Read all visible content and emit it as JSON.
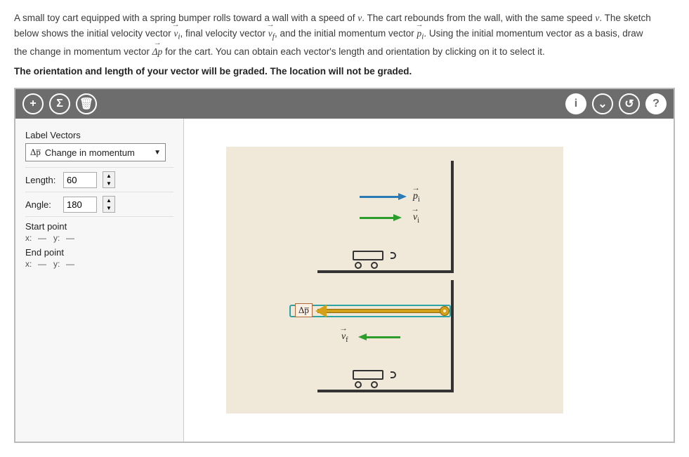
{
  "instructions": {
    "line1a": "A small toy cart equipped with a spring bumper rolls toward a wall with a speed of ",
    "v": "v",
    "line1b": ". The cart rebounds from the wall, with the same speed ",
    "line1c": ". The sketch",
    "line2a": "below shows the initial velocity vector ",
    "vi": "v",
    "vi_sub": "i",
    "line2b": ", final velocity vector ",
    "vf": "v",
    "vf_sub": "f",
    "line2c": ", and the initial momentum vector ",
    "pi": "p",
    "pi_sub": "i",
    "line2d": ". Using the initial momentum vector as a basis, draw",
    "line3a": "the change in momentum vector ",
    "dp": "Δp",
    "line3b": " for the cart. You can obtain each vector's length and orientation by clicking on it to select it."
  },
  "grading_note": "The orientation and length of your vector will be graded. The location will not be graded.",
  "toolbar": {
    "add": "+",
    "sum": "Σ",
    "trash": "🗑",
    "info": "i",
    "expand": "⌄",
    "reset": "↺",
    "help": "?"
  },
  "panel": {
    "label_vectors": "Label Vectors",
    "selected_vector_symbol": "Δp̅",
    "selected_vector_desc": "Change in momentum",
    "length_label": "Length:",
    "length_value": "60",
    "angle_label": "Angle:",
    "angle_value": "180",
    "start_point_label": "Start point",
    "end_point_label": "End point",
    "x_label": "x:",
    "y_label": "y:",
    "start_x": "—",
    "start_y": "—",
    "end_x": "—",
    "end_y": "—"
  },
  "canvas": {
    "pi_label": "p",
    "pi_sub": "i",
    "vi_label": "v",
    "vi_sub": "i",
    "vf_label": "v",
    "vf_sub": "f",
    "dp_label": "Δp̅"
  },
  "chart_data": {
    "type": "vector-diagram",
    "scenes": [
      {
        "name": "before",
        "cart_direction": "right",
        "vectors": [
          {
            "name": "p_i",
            "color": "#2a7ab8",
            "direction_deg": 0,
            "length": 60,
            "label": "pₗ"
          },
          {
            "name": "v_i",
            "color": "#2a9d2a",
            "direction_deg": 0,
            "length": 50,
            "label": "vₗ"
          }
        ]
      },
      {
        "name": "after",
        "cart_direction": "left",
        "vectors": [
          {
            "name": "v_f",
            "color": "#2a9d2a",
            "direction_deg": 180,
            "length": 50,
            "label": "v_f"
          },
          {
            "name": "delta_p_user",
            "color": "#d4a017",
            "direction_deg": 180,
            "length": 60,
            "label": "Δp",
            "selected": true
          }
        ]
      }
    ]
  }
}
